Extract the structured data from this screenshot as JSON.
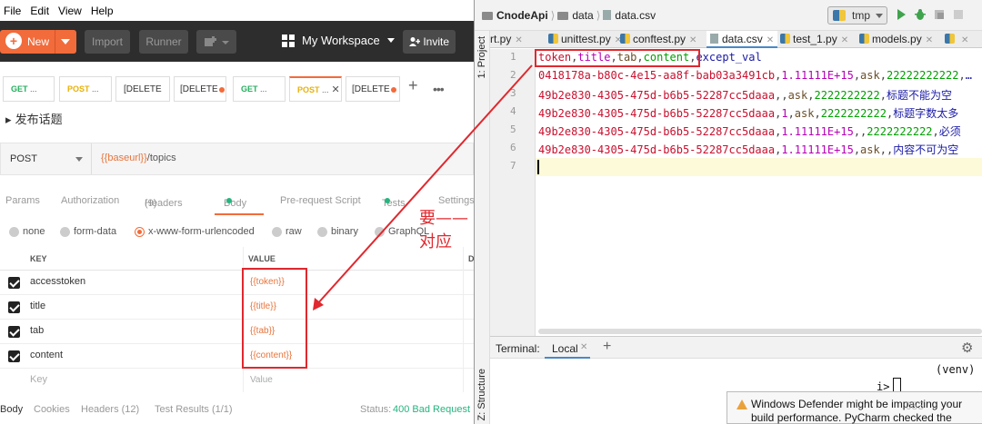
{
  "postman": {
    "menu": [
      "File",
      "Edit",
      "View",
      "Help"
    ],
    "toolbar": {
      "new_label": "New",
      "import_label": "Import",
      "runner_label": "Runner",
      "workspace_label": "My Workspace",
      "invite_label": "Invite"
    },
    "tabs": [
      {
        "method": "GET",
        "label": "..."
      },
      {
        "method": "POST",
        "label": "..."
      },
      {
        "method": "",
        "label": "[DELETE"
      },
      {
        "method": "",
        "label": "[DELETE"
      },
      {
        "method": "GET",
        "label": "..."
      },
      {
        "method": "POST",
        "label": "..."
      },
      {
        "method": "",
        "label": "[DELETE"
      }
    ],
    "tab_add": "+",
    "tab_more": "•••",
    "request_title": "▸ 发布话题",
    "method_select": "POST",
    "url_var": "{{baseurl}}",
    "url_path": "/topics",
    "request_tabs": {
      "params": "Params",
      "authorization": "Authorization",
      "headers": "Headers",
      "headers_count": "(9)",
      "body": "Body",
      "pre_request": "Pre-request Script",
      "tests": "Tests",
      "settings": "Settings"
    },
    "body_types": [
      "none",
      "form-data",
      "x-www-form-urlencoded",
      "raw",
      "binary",
      "GraphQL"
    ],
    "table": {
      "key_header": "KEY",
      "value_header": "VALUE",
      "desc_header": "D",
      "rows": [
        {
          "key": "accesstoken",
          "value": "{{token}}"
        },
        {
          "key": "title",
          "value": "{{title}}"
        },
        {
          "key": "tab",
          "value": "{{tab}}"
        },
        {
          "key": "content",
          "value": "{{content}}"
        }
      ],
      "key_placeholder": "Key",
      "value_placeholder": "Value"
    },
    "footer": {
      "body": "Body",
      "cookies": "Cookies",
      "headers": "Headers (12)",
      "test_results": "Test Results (1/1)",
      "status_label": "Status:",
      "status_value": "400 Bad Request"
    }
  },
  "annotation": {
    "label": "要——对应",
    "color": "#e0282e"
  },
  "pycharm": {
    "breadcrumbs": [
      "CnodeApi",
      "data",
      "data.csv"
    ],
    "run_config": "tmp",
    "editor_tabs": [
      "rt.py",
      "unittest.py",
      "conftest.py",
      "data.csv",
      "test_1.py",
      "models.py"
    ],
    "active_tab": "data.csv",
    "side_labels": [
      "1: Project",
      "Z: Structure"
    ],
    "line_numbers": [
      "1",
      "2",
      "3",
      "4",
      "5",
      "6",
      "7"
    ],
    "csv_lines": [
      [
        "token",
        "title",
        "tab",
        "content",
        "except_val"
      ],
      [
        "0418178a-b80c-4e15-aa8f-bab03a3491cb",
        "1.11111E+15",
        "ask",
        "22222222222",
        "…"
      ],
      [
        "49b2e830-4305-475d-b6b5-52287cc5daaa",
        "",
        "ask",
        "2222222222",
        "标题不能为空"
      ],
      [
        "49b2e830-4305-475d-b6b5-52287cc5daaa",
        "1",
        "ask",
        "2222222222",
        "标题字数太多"
      ],
      [
        "49b2e830-4305-475d-b6b5-52287cc5daaa",
        "1.11111E+15",
        "",
        "2222222222",
        "必须"
      ],
      [
        "49b2e830-4305-475d-b6b5-52287cc5daaa",
        "1.11111E+15",
        "ask",
        "",
        "内容不可为空"
      ]
    ],
    "terminal": {
      "title": "Terminal:",
      "tab": "Local",
      "venv": "(venv)",
      "prompt": "i>"
    },
    "notification": {
      "line1": "Windows Defender might be impacting your",
      "line2": "build performance. PyCharm checked the"
    },
    "watermark": "053"
  }
}
